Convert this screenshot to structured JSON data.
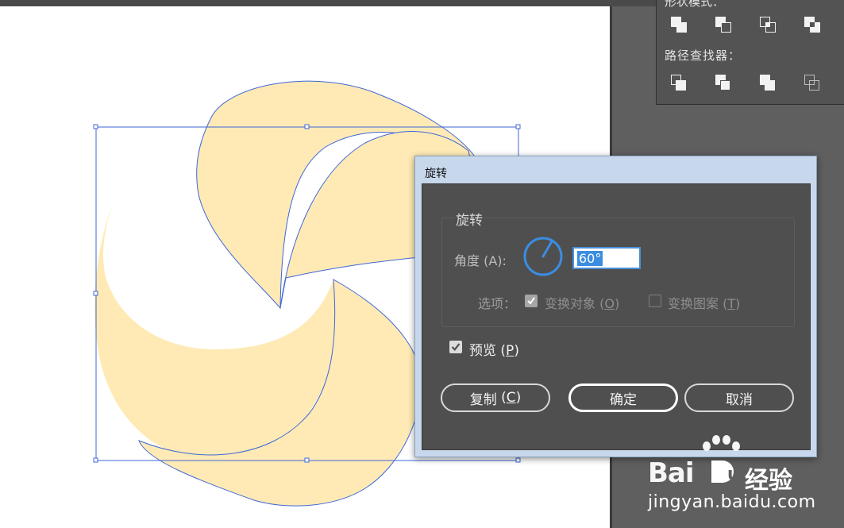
{
  "pathfinder": {
    "title_fragment": "形状模式：",
    "label": "路径查找器："
  },
  "dialog": {
    "title": "旋转",
    "group_label": "旋转",
    "angle_label": "角度 (A):",
    "angle_value": "60°",
    "options_label": "选项：",
    "transform_objects": {
      "label": "变换对象",
      "key": "O",
      "checked": true
    },
    "transform_patterns": {
      "label": "变换图案",
      "key": "T",
      "checked": false
    },
    "preview": {
      "label": "预览",
      "key": "P",
      "checked": true
    },
    "buttons": {
      "copy": {
        "label": "复制",
        "key": "C"
      },
      "ok": {
        "label": "确定"
      },
      "cancel": {
        "label": "取消"
      }
    }
  },
  "watermark": {
    "brand": "Bai",
    "brand_cn": "经验",
    "url": "jingyan.baidu.com"
  },
  "colors": {
    "shape_fill": "#ffeab5",
    "selection": "#3f67d8",
    "accent": "#3b8de0"
  }
}
